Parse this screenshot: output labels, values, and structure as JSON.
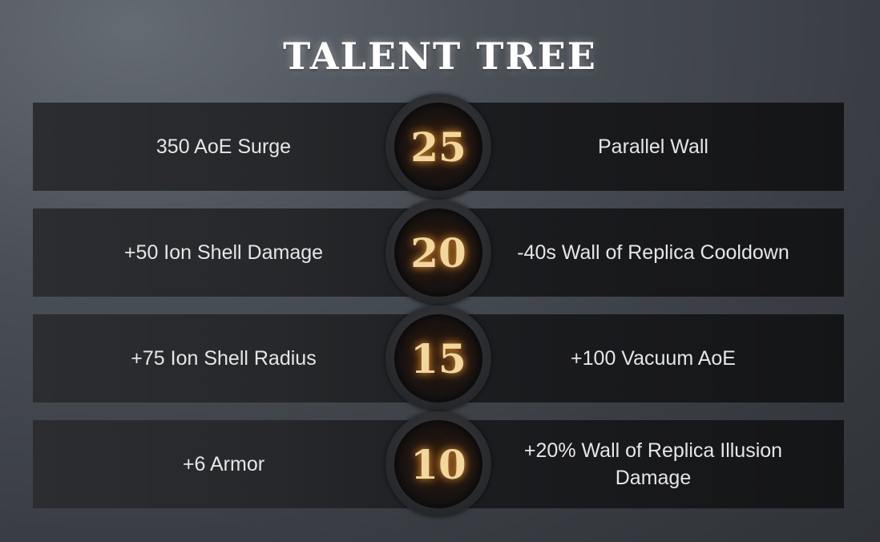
{
  "title": "TALENT TREE",
  "tiers": [
    {
      "level": "25",
      "left": "350 AoE Surge",
      "right": "Parallel Wall"
    },
    {
      "level": "20",
      "left": "+50 Ion Shell Damage",
      "right": "-40s Wall of Replica Cooldown"
    },
    {
      "level": "15",
      "left": "+75 Ion Shell Radius",
      "right": "+100 Vacuum AoE"
    },
    {
      "level": "10",
      "left": "+6 Armor",
      "right": "+20% Wall of Replica Illusion Damage"
    }
  ],
  "colors": {
    "level_text": "#f2d79c",
    "glow": "#ff9a30",
    "talent_text": "#e6e6e6"
  }
}
